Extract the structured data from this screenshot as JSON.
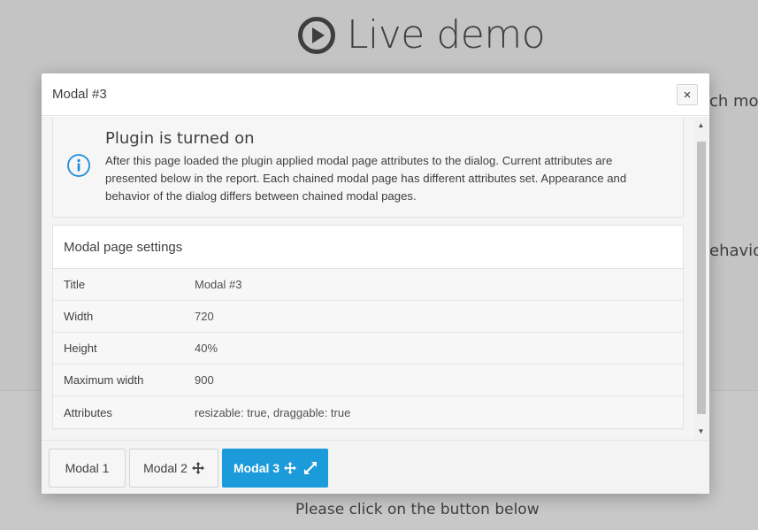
{
  "background": {
    "title": "Live demo",
    "peek_text_1": "ch mod",
    "peek_text_2": "ehavio",
    "below_text": "Please click on the button below"
  },
  "modal": {
    "title": "Modal #3",
    "close_label": "×",
    "alert": {
      "icon": "info-icon",
      "title": "Plugin is turned on",
      "text": "After this page loaded the plugin applied modal page attributes to the dialog. Current attributes are presented below in the report. Each chained modal page has different attributes set. Appearance and behavior of the dialog differs between chained modal pages."
    },
    "settings": {
      "heading": "Modal page settings",
      "rows": [
        {
          "label": "Title",
          "value": "Modal #3"
        },
        {
          "label": "Width",
          "value": "720"
        },
        {
          "label": "Height",
          "value": "40%"
        },
        {
          "label": "Maximum width",
          "value": "900"
        },
        {
          "label": "Attributes",
          "value": "resizable: true, draggable: true"
        }
      ]
    },
    "footer_buttons": [
      {
        "label": "Modal 1",
        "icons": []
      },
      {
        "label": "Modal 2",
        "icons": [
          "move-icon"
        ]
      },
      {
        "label": "Modal 3",
        "icons": [
          "move-icon",
          "expand-icon"
        ],
        "active": true
      }
    ]
  },
  "colors": {
    "overlay": "#c4c4c4",
    "accent": "#1b9bd9",
    "info_icon": "#1b8bd9"
  }
}
